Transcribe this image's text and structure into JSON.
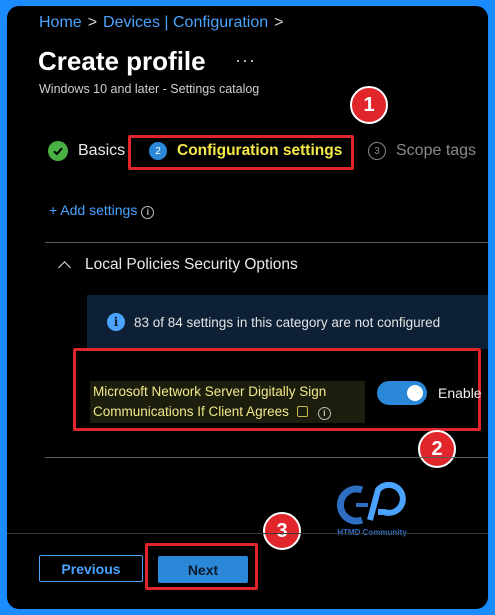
{
  "breadcrumb": {
    "home": "Home",
    "sep": ">",
    "section": "Devices | Configuration"
  },
  "page": {
    "title": "Create profile",
    "more": "···",
    "subtitle": "Windows 10 and later - Settings catalog"
  },
  "steps": [
    {
      "num": "",
      "label": "Basics",
      "state": "complete"
    },
    {
      "num": "2",
      "label": "Configuration settings",
      "state": "active"
    },
    {
      "num": "3",
      "label": "Scope tags",
      "state": "upcoming"
    }
  ],
  "annotations": {
    "one": "1",
    "two": "2",
    "three": "3"
  },
  "add_settings": {
    "label": "+ Add settings",
    "info": "i"
  },
  "section": {
    "title": "Local Policies Security Options"
  },
  "info_bar": {
    "icon": "i",
    "text": "83 of 84 settings in this category are not configured"
  },
  "setting": {
    "line1": "Microsoft Network Server Digitally Sign",
    "line2": "Communications If Client Agrees",
    "info": "i",
    "toggle_label": "Enable",
    "toggle_on": true
  },
  "footer": {
    "previous": "Previous",
    "next": "Next"
  },
  "logo": {
    "text": "HTMD Community"
  },
  "colors": {
    "accent": "#2b88d8",
    "link": "#4aa3ff",
    "highlight": "#e0252b",
    "frame": "#1a8cff"
  }
}
